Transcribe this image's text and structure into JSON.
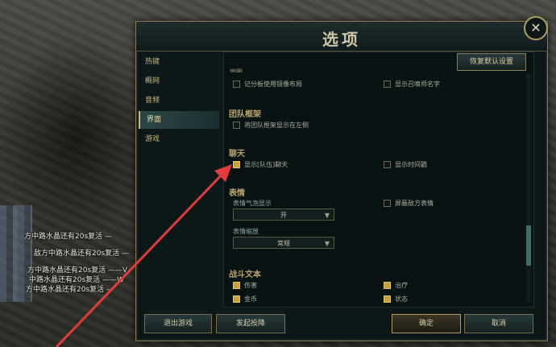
{
  "dialog": {
    "title": "选项"
  },
  "sidebar": {
    "items": [
      {
        "label": "热键"
      },
      {
        "label": "概网"
      },
      {
        "label": "音频"
      },
      {
        "label": "界面"
      },
      {
        "label": "游戏"
      }
    ],
    "active_index": 3
  },
  "restore_label": "恢复默认设置",
  "sections": {
    "top_partial_title": "地图",
    "scoreboard_mirror": {
      "label": "记分板使用镜像布局",
      "checked": false
    },
    "show_summoner_names": {
      "label": "显示召唤师名字",
      "checked": false
    },
    "team_frame": {
      "title": "团队框架",
      "show_left": {
        "label": "将团队框架显示在左侧",
        "checked": false
      }
    },
    "chat": {
      "title": "聊天",
      "show_team_chat": {
        "label": "显示[队伍]聊天",
        "checked": true
      },
      "show_timestamps": {
        "label": "显示时间戳",
        "checked": false
      }
    },
    "emotes": {
      "title": "表情",
      "bubble_label": "表情气泡显示",
      "bubble_value": "开",
      "block_enemy": {
        "label": "屏蔽敌方表情",
        "checked": false
      },
      "scale_label": "表情缩放",
      "scale_value": "常规"
    },
    "combat_text": {
      "title": "战斗文本",
      "damage": {
        "label": "伤害",
        "checked": true
      },
      "heal": {
        "label": "治疗",
        "checked": true
      },
      "gold": {
        "label": "金币",
        "checked": true
      },
      "status": {
        "label": "状态",
        "checked": true
      }
    }
  },
  "footer": {
    "exit_game": "退出游戏",
    "surrender": "发起投降",
    "ok": "确定",
    "cancel": "取消"
  },
  "chat_log": [
    "方中路水晶还有20s复活 —",
    "敌方中路水晶还有20s复活 —",
    "方中路水晶还有20s复活 ——V",
    "中路水晶还有20s复活 ——W",
    "方中路水晶还有20s复活 —"
  ],
  "colors": {
    "accent_gold": "#c8a13c",
    "frame_border": "#8a7a52",
    "annotation_arrow": "#e23b3b"
  },
  "icons": {
    "close": "close-icon",
    "dropdown": "chevron-down-icon"
  }
}
